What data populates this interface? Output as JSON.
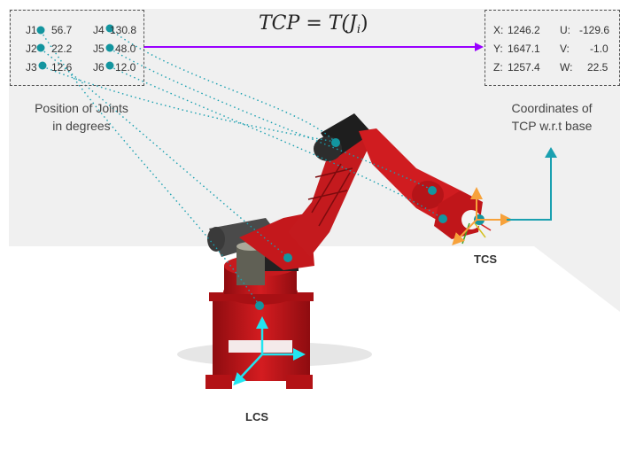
{
  "formula": {
    "lhs": "TCP",
    "eq": "=",
    "fn": "T(J",
    "sub": "i",
    "close": ")"
  },
  "joints": {
    "caption_line1": "Position of Joints",
    "caption_line2": "in degrees",
    "items": [
      {
        "name": "J1",
        "value": "56.7"
      },
      {
        "name": "J2",
        "value": "22.2"
      },
      {
        "name": "J3",
        "value": "12.6"
      },
      {
        "name": "J4",
        "value": "130.8"
      },
      {
        "name": "J5",
        "value": "48.0"
      },
      {
        "name": "J6",
        "value": "12.0"
      }
    ]
  },
  "coordinates": {
    "caption_line1": "Coordinates of",
    "caption_line2": "TCP w.r.t base",
    "items": [
      {
        "label": "X:",
        "value": "1246.2"
      },
      {
        "label": "Y:",
        "value": "1647.1"
      },
      {
        "label": "Z:",
        "value": "1257.4"
      },
      {
        "label": "U:",
        "value": "-129.6"
      },
      {
        "label": "V:",
        "value": "-1.0"
      },
      {
        "label": "W:",
        "value": "22.5"
      }
    ]
  },
  "frames": {
    "tcs": "TCS",
    "lcs": "LCS"
  },
  "colors": {
    "background_panel": "#f0f0f0",
    "joint_marker": "#13959f",
    "arrow_purple": "#9900ff",
    "axis_cyan": "#22e5f0",
    "axis_orange": "#f7a23b",
    "axis_teal": "#1aa0b0",
    "robot_red": "#c0161a"
  }
}
